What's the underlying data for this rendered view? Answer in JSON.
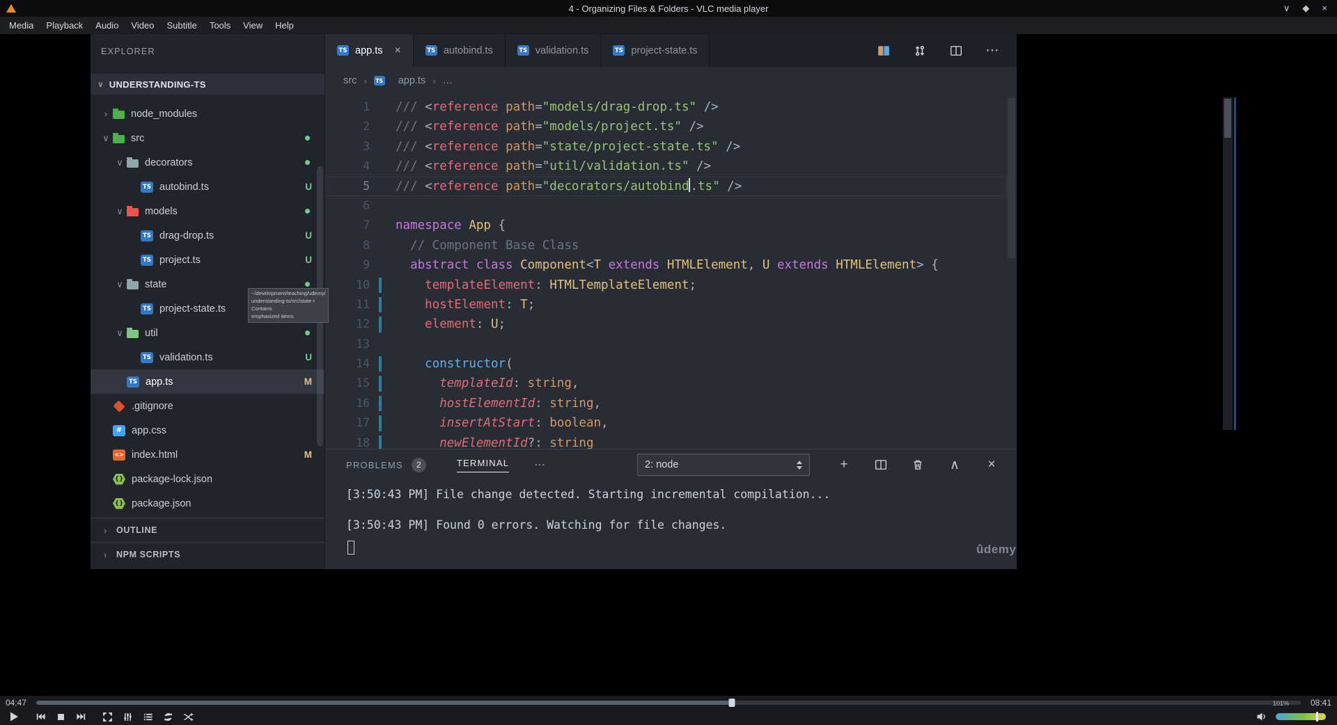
{
  "window": {
    "title": "4 - Organizing Files & Folders - VLC media player",
    "menu": [
      "Media",
      "Playback",
      "Audio",
      "Video",
      "Subtitle",
      "Tools",
      "View",
      "Help"
    ]
  },
  "icons": {
    "chevron_expanded": "∨",
    "chevron_collapsed": "›",
    "breadcrumb_separator": "›",
    "close": "×",
    "more": "⋯",
    "plus": "+",
    "collapse_up": "∧",
    "window_minimize": "∨",
    "window_maximize": "◆",
    "window_close": "×"
  },
  "vlc": {
    "time_elapsed": "04:47",
    "time_total": "08:41",
    "progress_percent": 55,
    "volume_label": "101%",
    "volume_marker_percent": 80
  },
  "vscode": {
    "explorer": {
      "title": "EXPLORER",
      "project": "UNDERSTANDING-TS",
      "tree": [
        {
          "name": "node_modules",
          "kind": "folder",
          "color": "#4caf50",
          "indent": 0,
          "chevron": "collapsed"
        },
        {
          "name": "src",
          "kind": "folder",
          "color": "#4caf50",
          "indent": 0,
          "chevron": "expanded",
          "dot": true
        },
        {
          "name": "decorators",
          "kind": "folder",
          "color": "#90a4ae",
          "indent": 1,
          "chevron": "expanded",
          "dot": true
        },
        {
          "name": "autobind.ts",
          "kind": "ts",
          "indent": 2,
          "badge": "U"
        },
        {
          "name": "models",
          "kind": "folder",
          "color": "#ef5350",
          "indent": 1,
          "chevron": "expanded",
          "dot": true
        },
        {
          "name": "drag-drop.ts",
          "kind": "ts",
          "indent": 2,
          "badge": "U"
        },
        {
          "name": "project.ts",
          "kind": "ts",
          "indent": 2,
          "badge": "U"
        },
        {
          "name": "state",
          "kind": "folder",
          "color": "#90a4ae",
          "indent": 1,
          "chevron": "expanded",
          "dot": true
        },
        {
          "name": "project-state.ts",
          "kind": "ts",
          "indent": 2
        },
        {
          "name": "util",
          "kind": "folder",
          "color": "#81c784",
          "indent": 1,
          "chevron": "expanded",
          "dot": true
        },
        {
          "name": "validation.ts",
          "kind": "ts",
          "indent": 2,
          "badge": "U"
        },
        {
          "name": "app.ts",
          "kind": "ts",
          "indent": 1,
          "badge": "M",
          "selected": true
        },
        {
          "name": ".gitignore",
          "kind": "git",
          "indent": 0
        },
        {
          "name": "app.css",
          "kind": "css",
          "indent": 0
        },
        {
          "name": "index.html",
          "kind": "html",
          "indent": 0,
          "badge": "M"
        },
        {
          "name": "package-lock.json",
          "kind": "json",
          "indent": 0
        },
        {
          "name": "package.json",
          "kind": "json",
          "indent": 0
        }
      ],
      "sections": [
        {
          "label": "OUTLINE"
        },
        {
          "label": "NPM SCRIPTS"
        }
      ],
      "tooltip": {
        "lines": [
          "~/development/teaching/udemy/",
          "understanding-ts/src/state • Contains",
          "emphasized items"
        ]
      }
    },
    "tabs": [
      {
        "label": "app.ts",
        "active": true
      },
      {
        "label": "autobind.ts"
      },
      {
        "label": "validation.ts"
      },
      {
        "label": "project-state.ts"
      }
    ],
    "breadcrumb": [
      "src",
      "app.ts",
      "…"
    ],
    "editor": {
      "lines": [
        {
          "n": 1,
          "tokens": [
            [
              "cmt",
              "/// "
            ],
            [
              "pun",
              "<"
            ],
            [
              "tag",
              "reference"
            ],
            [
              "attr",
              " path"
            ],
            [
              "pun",
              "="
            ],
            [
              "str",
              "\"models/drag-drop.ts\""
            ],
            [
              "pun",
              " />"
            ]
          ]
        },
        {
          "n": 2,
          "tokens": [
            [
              "cmt",
              "/// "
            ],
            [
              "pun",
              "<"
            ],
            [
              "tag",
              "reference"
            ],
            [
              "attr",
              " path"
            ],
            [
              "pun",
              "="
            ],
            [
              "str",
              "\"models/project.ts\""
            ],
            [
              "pun",
              " />"
            ]
          ]
        },
        {
          "n": 3,
          "tokens": [
            [
              "cmt",
              "/// "
            ],
            [
              "pun",
              "<"
            ],
            [
              "tag",
              "reference"
            ],
            [
              "attr",
              " path"
            ],
            [
              "pun",
              "="
            ],
            [
              "str",
              "\"state/project-state.ts\""
            ],
            [
              "pun",
              " />"
            ]
          ]
        },
        {
          "n": 4,
          "tokens": [
            [
              "cmt",
              "/// "
            ],
            [
              "pun",
              "<"
            ],
            [
              "tag",
              "reference"
            ],
            [
              "attr",
              " path"
            ],
            [
              "pun",
              "="
            ],
            [
              "str",
              "\"util/validation.ts\""
            ],
            [
              "pun",
              " />"
            ]
          ]
        },
        {
          "n": 5,
          "cur": true,
          "tokens": [
            [
              "cmt",
              "/// "
            ],
            [
              "pun",
              "<"
            ],
            [
              "tag",
              "reference"
            ],
            [
              "attr",
              " path"
            ],
            [
              "pun",
              "="
            ],
            [
              "str",
              "\"decorators/autobind"
            ],
            [
              "cursor",
              ""
            ],
            [
              "str",
              ".ts\""
            ],
            [
              "pun",
              " />"
            ]
          ]
        },
        {
          "n": 6,
          "tokens": []
        },
        {
          "n": 7,
          "tokens": [
            [
              "kw",
              "namespace"
            ],
            [
              "type",
              " App"
            ],
            [
              "pun",
              " {"
            ]
          ]
        },
        {
          "n": 8,
          "tokens": [
            [
              "cmt",
              "  // Component Base Class"
            ]
          ]
        },
        {
          "n": 9,
          "tokens": [
            [
              "pun",
              "  "
            ],
            [
              "kw",
              "abstract class"
            ],
            [
              "type",
              " Component"
            ],
            [
              "pun",
              "<"
            ],
            [
              "type",
              "T"
            ],
            [
              "kw",
              " extends"
            ],
            [
              "type",
              " HTMLElement"
            ],
            [
              "pun",
              ", "
            ],
            [
              "type",
              "U"
            ],
            [
              "kw",
              " extends"
            ],
            [
              "type",
              " HTMLElement"
            ],
            [
              "pun",
              "> {"
            ]
          ]
        },
        {
          "n": 10,
          "mod": true,
          "tokens": [
            [
              "pun",
              "    "
            ],
            [
              "prop",
              "templateElement"
            ],
            [
              "pun",
              ": "
            ],
            [
              "type",
              "HTMLTemplateElement"
            ],
            [
              "pun",
              ";"
            ]
          ]
        },
        {
          "n": 11,
          "mod": true,
          "tokens": [
            [
              "pun",
              "    "
            ],
            [
              "prop",
              "hostElement"
            ],
            [
              "pun",
              ": "
            ],
            [
              "type",
              "T"
            ],
            [
              "pun",
              ";"
            ]
          ]
        },
        {
          "n": 12,
          "mod": true,
          "tokens": [
            [
              "pun",
              "    "
            ],
            [
              "prop",
              "element"
            ],
            [
              "pun",
              ": "
            ],
            [
              "type",
              "U"
            ],
            [
              "pun",
              ";"
            ]
          ]
        },
        {
          "n": 13,
          "tokens": []
        },
        {
          "n": 14,
          "mod": true,
          "tokens": [
            [
              "pun",
              "    "
            ],
            [
              "fn",
              "constructor"
            ],
            [
              "pun",
              "("
            ]
          ]
        },
        {
          "n": 15,
          "mod": true,
          "tokens": [
            [
              "pun",
              "      "
            ],
            [
              "param",
              "templateId"
            ],
            [
              "pun",
              ": "
            ],
            [
              "ptype",
              "string"
            ],
            [
              "pun",
              ","
            ]
          ]
        },
        {
          "n": 16,
          "mod": true,
          "tokens": [
            [
              "pun",
              "      "
            ],
            [
              "param",
              "hostElementId"
            ],
            [
              "pun",
              ": "
            ],
            [
              "ptype",
              "string"
            ],
            [
              "pun",
              ","
            ]
          ]
        },
        {
          "n": 17,
          "mod": true,
          "tokens": [
            [
              "pun",
              "      "
            ],
            [
              "param",
              "insertAtStart"
            ],
            [
              "pun",
              ": "
            ],
            [
              "ptype",
              "boolean"
            ],
            [
              "pun",
              ","
            ]
          ]
        },
        {
          "n": 18,
          "mod": true,
          "tokens": [
            [
              "pun",
              "      "
            ],
            [
              "param",
              "newElementId"
            ],
            [
              "pun",
              "?: "
            ],
            [
              "ptype",
              "string"
            ]
          ]
        }
      ]
    },
    "panel": {
      "problems_label": "PROBLEMS",
      "problems_count": "2",
      "terminal_label": "TERMINAL",
      "shell_select": "2: node",
      "output": [
        "[3:50:43 PM] File change detected. Starting incremental compilation...",
        "",
        "[3:50:43 PM] Found 0 errors. Watching for file changes."
      ]
    },
    "watermark": "ûdemy"
  }
}
